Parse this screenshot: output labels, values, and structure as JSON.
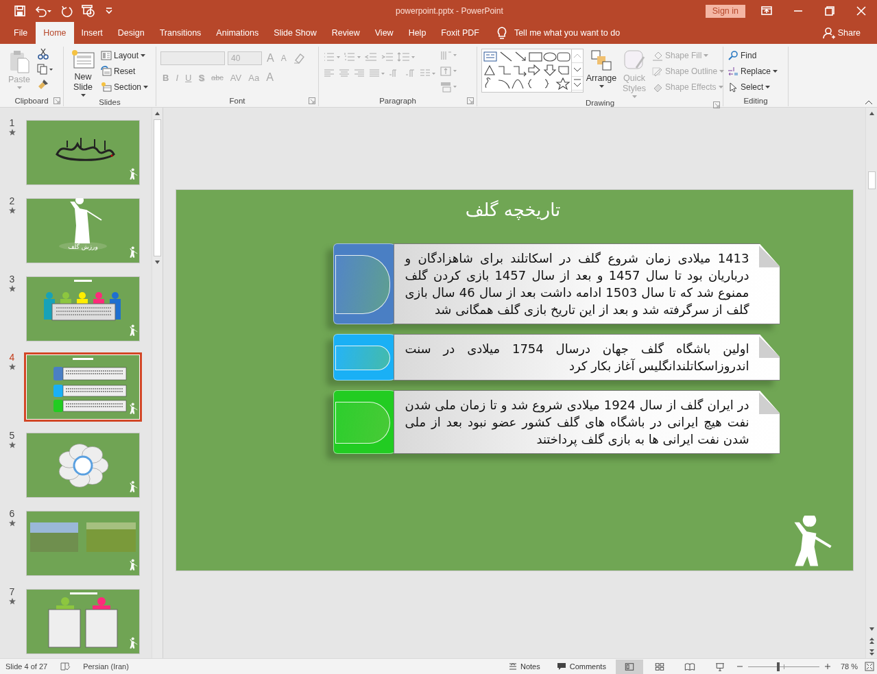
{
  "title_bar": {
    "title": "powerpoint.pptx  -  PowerPoint",
    "sign_in": "Sign in"
  },
  "tabs": [
    {
      "label": "File",
      "selected": false
    },
    {
      "label": "Home",
      "selected": true
    },
    {
      "label": "Insert",
      "selected": false
    },
    {
      "label": "Design",
      "selected": false
    },
    {
      "label": "Transitions",
      "selected": false
    },
    {
      "label": "Animations",
      "selected": false
    },
    {
      "label": "Slide Show",
      "selected": false
    },
    {
      "label": "Review",
      "selected": false
    },
    {
      "label": "View",
      "selected": false
    },
    {
      "label": "Help",
      "selected": false
    },
    {
      "label": "Foxit PDF",
      "selected": false
    }
  ],
  "tell_me": "Tell me what you want to do",
  "share": "Share",
  "ribbon": {
    "groups": [
      {
        "kind": "clipboard",
        "label": "Clipboard",
        "paste": {
          "label": "Paste",
          "disabled": true
        }
      },
      {
        "kind": "slides",
        "label": "Slides",
        "new_slide": "New Slide",
        "items": [
          "Layout",
          "Reset",
          "Section"
        ]
      },
      {
        "kind": "font",
        "label": "Font",
        "font_size": "40",
        "size_buttons": [
          "A",
          "A"
        ],
        "format_buttons": [
          "B",
          "I",
          "U",
          "S",
          "abc",
          "AV",
          "Aa",
          "A"
        ]
      },
      {
        "kind": "paragraph",
        "label": "Paragraph"
      },
      {
        "kind": "drawing",
        "label": "Drawing",
        "arrange": "Arrange",
        "quick_styles": {
          "label": "Quick Styles",
          "disabled": true
        },
        "shape_items": [
          {
            "label": "Shape Fill",
            "disabled": true
          },
          {
            "label": "Shape Outline",
            "disabled": true
          },
          {
            "label": "Shape Effects",
            "disabled": true
          }
        ]
      },
      {
        "kind": "editing",
        "label": "Editing",
        "items": [
          "Find",
          "Replace",
          "Select"
        ]
      }
    ]
  },
  "thumbnails": [
    {
      "number": "1",
      "selected": false,
      "kind": "calligraphy"
    },
    {
      "number": "2",
      "selected": false,
      "kind": "golfer",
      "caption": "ورزش گلف"
    },
    {
      "number": "3",
      "selected": false,
      "kind": "people"
    },
    {
      "number": "4",
      "selected": true,
      "kind": "timeline"
    },
    {
      "number": "5",
      "selected": false,
      "kind": "flower"
    },
    {
      "number": "6",
      "selected": false,
      "kind": "photos"
    },
    {
      "number": "7",
      "selected": false,
      "kind": "pair"
    }
  ],
  "slide": {
    "title": "تاریخچه گلف",
    "cards": [
      {
        "color": "#4a7fc4",
        "text": "1413 میلادی زمان شروع گلف در اسکاتلند برای شاهزادگان و درباریان بود تا سال 1457 و بعد از سال  1457 بازی کردن گلف ممنوع شد که تا سال 1503 ادامه داشت بعد از سال 46 سال بازی گلف از سرگرفته شد و بعد از این تاریخ بازی گلف همگانی شد"
      },
      {
        "color": "#1ab0f5",
        "text": "اولین باشگاه گلف جهان درسال 1754 میلادی در سنت اندروزاسکاتلندانگلیس آغاز بکار کرد"
      },
      {
        "color": "#22cc22",
        "text": "در ایران گلف از سال 1924 میلادی شروع شد و تا زمان ملی شدن نفت هیچ ایرانی در باشگاه های گلف کشور عضو نبود بعد از ملی شدن نفت ایرانی ها به بازی گلف پرداختند"
      }
    ]
  },
  "status_bar": {
    "slide_info": "Slide 4 of 27",
    "language": "Persian (Iran)",
    "notes": "Notes",
    "comments": "Comments",
    "views": [
      {
        "kind": "normal",
        "selected": true
      },
      {
        "kind": "sorter",
        "selected": false
      },
      {
        "kind": "reading",
        "selected": false
      },
      {
        "kind": "slideshow",
        "selected": false
      }
    ],
    "zoom": {
      "level": 0.42,
      "reading": "78 %"
    }
  }
}
